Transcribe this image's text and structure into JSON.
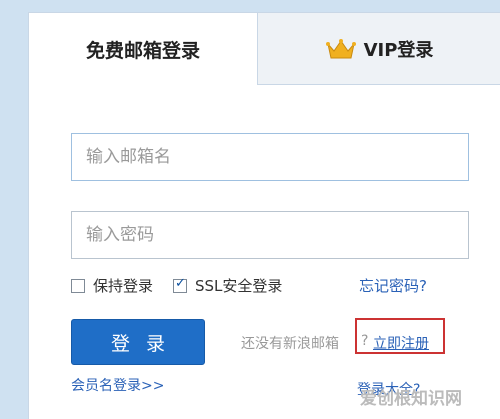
{
  "tabs": {
    "free_login": "免费邮箱登录",
    "vip_login": "VIP登录"
  },
  "form": {
    "email_placeholder": "输入邮箱名",
    "password_placeholder": "输入密码"
  },
  "options": {
    "keep_login": "保持登录",
    "keep_login_checked": false,
    "ssl_login": "SSL安全登录",
    "ssl_login_checked": true,
    "forgot_password": "忘记密码?"
  },
  "actions": {
    "login_button": "登录",
    "no_account_text": "还没有新浪邮箱",
    "question_mark": "?",
    "register_link": "立即注册",
    "member_login": "会员名登录>>",
    "bottom_right": "登录大全?"
  },
  "watermark": "爱创根知识网",
  "colors": {
    "accent": "#1f6ec7",
    "link": "#2b62b7",
    "highlight_border": "#cc3333",
    "background": "#cfe1f1"
  },
  "icons": {
    "vip_icon": "crown-icon",
    "checkmark": "checkmark-icon"
  }
}
